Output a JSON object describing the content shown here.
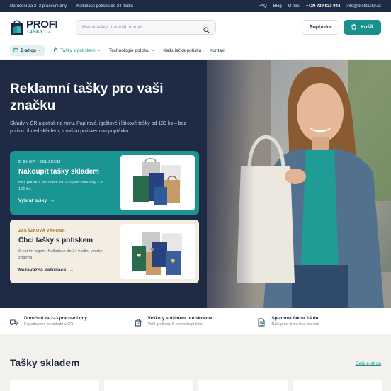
{
  "topbar": {
    "delivery": "Doručení za 2–3 pracovní dny",
    "quote": "Kalkulace potisku do 24 hodin",
    "links": [
      "FAQ",
      "Blog",
      "O nás"
    ],
    "phone": "+420 739 933 944",
    "email": "info@profitasky.cz"
  },
  "header": {
    "logo_line1": "PROFI",
    "logo_line2": "TAŠKY.CZ",
    "search_placeholder": "Hledat tašky, materiál, rozměr…",
    "inquiry_label": "Poptávka",
    "cart_label": "Košík"
  },
  "nav": {
    "eshop": "E-shop",
    "printed_bags": "Tašky s potiskem",
    "print_tech": "Technologie potisku",
    "calculator": "Kalkulačka potisku",
    "contact": "Kontakt"
  },
  "hero": {
    "title": "Reklamní tašky pro vaši značku",
    "subtitle": "Sklady v ČR a potisk na míru. Papírové, igelitové i látkové tašky od 100 ks – bez potisku ihned skladem, s vaším potiskem na poptávku.",
    "card_stock": {
      "kicker": "E-SHOP · SKLADEM",
      "title": "Nakoupit tašky skladem",
      "desc": "Bez potisku, doručení za 2–3 pracovní dny. Od 100 ks.",
      "cta": "Vybrat tašky"
    },
    "card_custom": {
      "kicker": "ZAKÁZKOVÁ VÝROBA",
      "title": "Chci tašky s potiskem",
      "desc": "S vaším logem. Kalkulace do 24 hodin, vzorky zdarma.",
      "cta": "Nezávazná kalkulace"
    }
  },
  "features": [
    {
      "title": "Doručení za 2–3 pracovní dny",
      "sub": "Expedujeme ze skladů v ČR",
      "icon": "truck-icon"
    },
    {
      "title": "Veškerý sortiment potiskneme",
      "sub": "Vaši grafikou, 5 technologií tisku",
      "icon": "bag-print-icon"
    },
    {
      "title": "Splatnost faktur 14 dní",
      "sub": "Nákup na firmu bez starostí",
      "icon": "invoice-icon"
    }
  ],
  "section": {
    "title": "Tašky skladem",
    "all_link": "Celý e-shop"
  },
  "colors": {
    "navy": "#1f2a44",
    "teal": "#1a8f8f",
    "cream": "#f4ede2"
  }
}
